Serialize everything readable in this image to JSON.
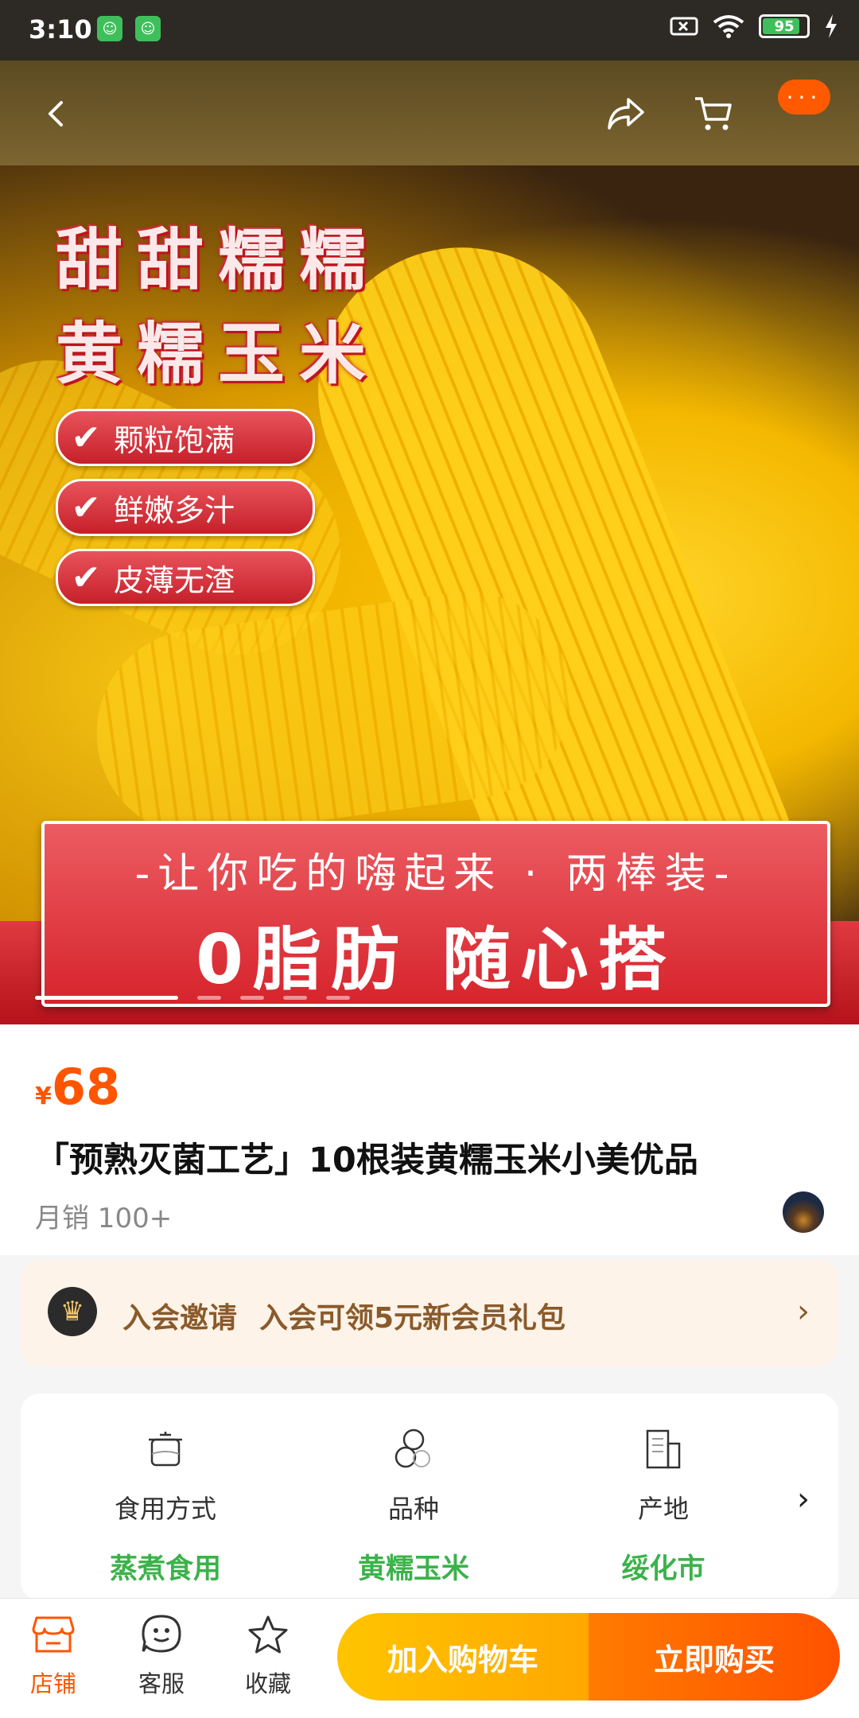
{
  "status_bar": {
    "time": "3:10",
    "battery": "95"
  },
  "hero": {
    "title_line1": "甜甜糯糯",
    "title_line2": "黄糯玉米",
    "badges": [
      "颗粒饱满",
      "鲜嫩多汁",
      "皮薄无渣"
    ],
    "banner_line1": "-让你吃的嗨起来 · 两棒装-",
    "banner_line2": "0脂肪 随心搭",
    "image_index": 1,
    "image_count": 5
  },
  "product": {
    "currency": "¥",
    "price": "68",
    "title": "「预熟灭菌工艺」10根装黄糯玉米小美优品",
    "sales": "月销 100+"
  },
  "member": {
    "label": "入会邀请",
    "text": "入会可领5元新会员礼包"
  },
  "attributes": [
    {
      "label": "食用方式",
      "value": "蒸煮食用",
      "icon": "pot-icon"
    },
    {
      "label": "品种",
      "value": "黄糯玉米",
      "icon": "variety-icon"
    },
    {
      "label": "产地",
      "value": "绥化市",
      "icon": "building-icon"
    }
  ],
  "bottom_bar": {
    "store": "店铺",
    "service": "客服",
    "favorite": "收藏",
    "add_to_cart": "加入购物车",
    "buy_now": "立即购买"
  },
  "colors": {
    "price": "#ff5500",
    "attr_value": "#3bb24a",
    "cart": "#ffb300",
    "buy": "#ff5a00"
  }
}
